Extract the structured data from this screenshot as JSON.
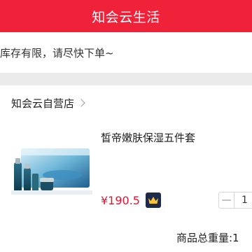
{
  "header": {
    "title": "知会云生活"
  },
  "notice": {
    "text": "库存有限，请尽快下单~"
  },
  "store": {
    "name": "知会云自营店"
  },
  "product": {
    "name": "皙帝嫩肤保湿五件套",
    "price": "¥190.5",
    "quantity": "1",
    "decrease_symbol": "—"
  },
  "summary": {
    "weight_label": "商品总重量:1"
  },
  "colors": {
    "brand": "#f0223a",
    "price": "#e3132e",
    "vip_bg": "#1d2a48",
    "vip_crown": "#f3c43a"
  },
  "icons": {
    "chevron": "chevron-right-icon",
    "vip": "crown-icon"
  }
}
